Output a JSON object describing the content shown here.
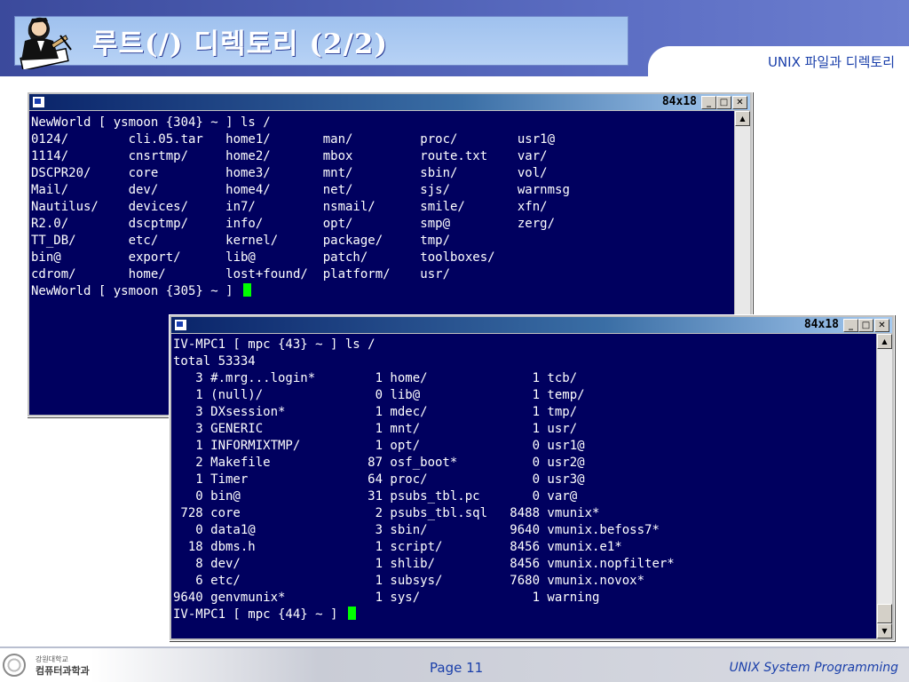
{
  "slide": {
    "title": "루트(/) 디렉토리 (2/2)",
    "subtitle": "UNIX 파일과 디렉토리"
  },
  "terminals": [
    {
      "size_label": "84x18",
      "lines": [
        "NewWorld [ ysmoon {304} ~ ] ls /",
        "0124/        cli.05.tar   home1/       man/         proc/        usr1@",
        "1114/        cnsrtmp/     home2/       mbox         route.txt    var/",
        "DSCPR20/     core         home3/       mnt/         sbin/        vol/",
        "Mail/        dev/         home4/       net/         sjs/         warnmsg",
        "Nautilus/    devices/     in7/         nsmail/      smile/       xfn/",
        "R2.0/        dscptmp/     info/        opt/         smp@         zerg/",
        "TT_DB/       etc/         kernel/      package/     tmp/",
        "bin@         export/      lib@         patch/       toolboxes/",
        "cdrom/       home/        lost+found/  platform/    usr/"
      ],
      "prompt": "NewWorld [ ysmoon {305} ~ ] "
    },
    {
      "size_label": "84x18",
      "lines": [
        "IV-MPC1 [ mpc {43} ~ ] ls /",
        "total 53334",
        "   3 #.mrg...login*        1 home/              1 tcb/",
        "   1 (null)/               0 lib@               1 temp/",
        "   3 DXsession*            1 mdec/              1 tmp/",
        "   3 GENERIC               1 mnt/               1 usr/",
        "   1 INFORMIXTMP/          1 opt/               0 usr1@",
        "   2 Makefile             87 osf_boot*          0 usr2@",
        "   1 Timer                64 proc/              0 usr3@",
        "   0 bin@                 31 psubs_tbl.pc       0 var@",
        " 728 core                  2 psubs_tbl.sql   8488 vmunix*",
        "   0 data1@                3 sbin/           9640 vmunix.befoss7*",
        "  18 dbms.h                1 script/         8456 vmunix.e1*",
        "   8 dev/                  1 shlib/          8456 vmunix.nopfilter*",
        "   6 etc/                  1 subsys/         7680 vmunix.novox*",
        "9640 genvmunix*            1 sys/               1 warning"
      ],
      "prompt": "IV-MPC1 [ mpc {44} ~ ] "
    }
  ],
  "window_buttons": {
    "minimize": "_",
    "maximize": "□",
    "close": "✕"
  },
  "footer": {
    "logo_line1": "강원대학교",
    "logo_line2": "컴퓨터과학과",
    "page": "Page 11",
    "course": "UNIX System Programming"
  },
  "colors": {
    "terminal_bg": "#00005f",
    "terminal_fg": "#ffffff",
    "cursor": "#00ff00",
    "accent_text": "#1a3faa"
  },
  "icons": [
    "clipart-writer-icon",
    "system-menu-icon",
    "scroll-up-icon",
    "scroll-down-icon",
    "university-seal-icon"
  ]
}
